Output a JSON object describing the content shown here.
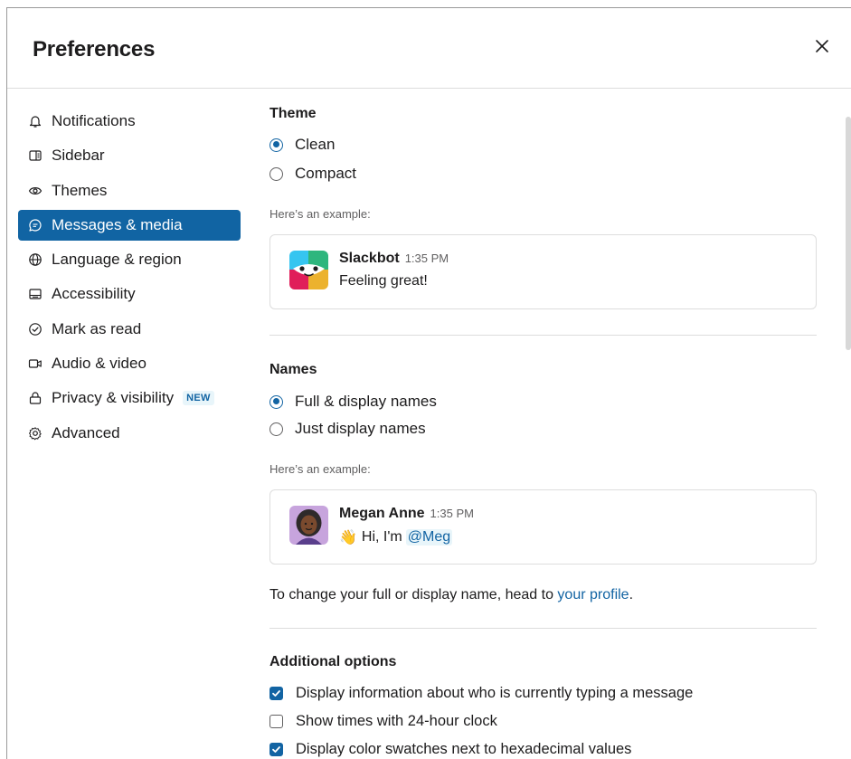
{
  "header": {
    "title": "Preferences"
  },
  "sidebar": {
    "items": [
      {
        "label": "Notifications",
        "icon": "bell-icon",
        "active": false
      },
      {
        "label": "Sidebar",
        "icon": "sidebar-icon",
        "active": false
      },
      {
        "label": "Themes",
        "icon": "eye-icon",
        "active": false
      },
      {
        "label": "Messages & media",
        "icon": "message-icon",
        "active": true
      },
      {
        "label": "Language & region",
        "icon": "globe-icon",
        "active": false
      },
      {
        "label": "Accessibility",
        "icon": "keyboard-icon",
        "active": false
      },
      {
        "label": "Mark as read",
        "icon": "check-circle-icon",
        "active": false
      },
      {
        "label": "Audio & video",
        "icon": "video-icon",
        "active": false
      },
      {
        "label": "Privacy & visibility",
        "icon": "lock-icon",
        "active": false,
        "badge": "NEW"
      },
      {
        "label": "Advanced",
        "icon": "gear-icon",
        "active": false
      }
    ]
  },
  "theme": {
    "title": "Theme",
    "options": [
      {
        "label": "Clean",
        "checked": true
      },
      {
        "label": "Compact",
        "checked": false
      }
    ],
    "example_label": "Here’s an example:",
    "example": {
      "name": "Slackbot",
      "time": "1:35 PM",
      "text": "Feeling great!"
    }
  },
  "names": {
    "title": "Names",
    "options": [
      {
        "label": "Full & display names",
        "checked": true
      },
      {
        "label": "Just display names",
        "checked": false
      }
    ],
    "example_label": "Here’s an example:",
    "example": {
      "name": "Megan Anne",
      "time": "1:35 PM",
      "emoji": "👋",
      "text": "Hi, I'm",
      "mention": "@Meg"
    },
    "profile_text": "To change your full or display name, head to",
    "profile_link": "your profile",
    "profile_suffix": "."
  },
  "additional": {
    "title": "Additional options",
    "options": [
      {
        "label": "Display information about who is currently typing a message",
        "checked": true
      },
      {
        "label": "Show times with 24-hour clock",
        "checked": false
      },
      {
        "label": "Display color swatches next to hexadecimal values",
        "checked": true
      }
    ]
  },
  "colors": {
    "accent": "#1264a3",
    "active_nav": "#1164a3",
    "text": "#1d1c1d",
    "muted": "#616061",
    "border": "#dddddd"
  }
}
